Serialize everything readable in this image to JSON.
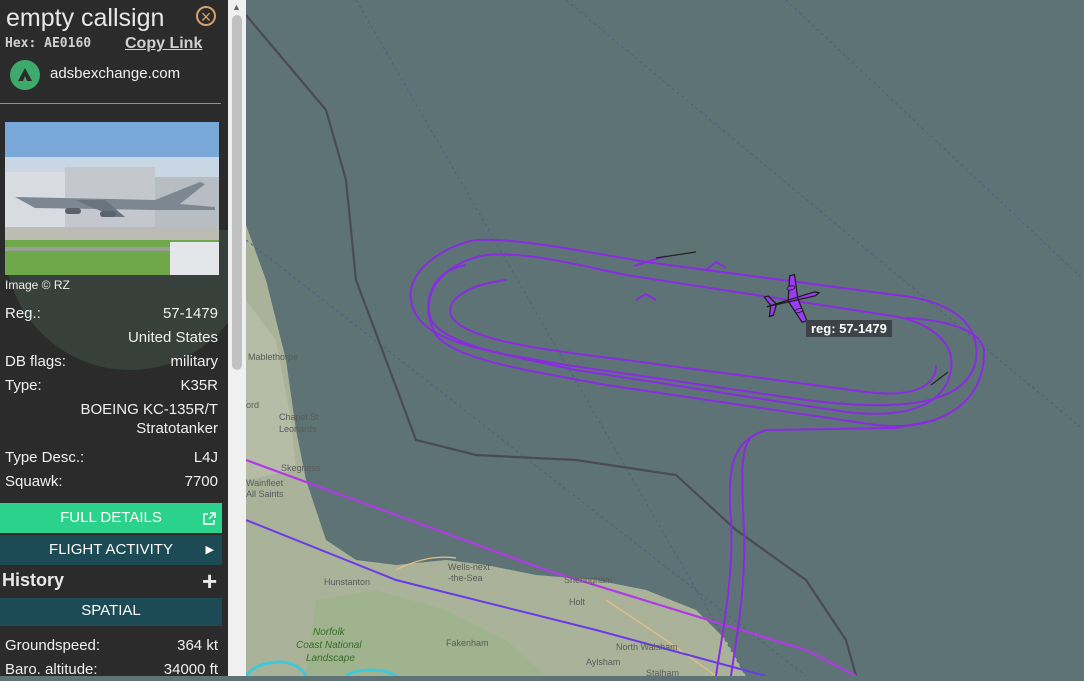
{
  "sidebar": {
    "title": "empty callsign",
    "hex_label": "Hex:",
    "hex_value": "AE0160",
    "copy_link": "Copy Link",
    "site": "adsbexchange.com",
    "image_credit": "Image © RZ",
    "fields": [
      {
        "label": "Reg.:",
        "value": "57-1479"
      },
      {
        "label": "",
        "value": "United States"
      },
      {
        "label": "DB flags:",
        "value": "military"
      },
      {
        "label": "Type:",
        "value": "K35R"
      },
      {
        "label": "",
        "value": "BOEING KC-135R/T"
      },
      {
        "label": "",
        "value": "Stratotanker"
      },
      {
        "label": "Type Desc.:",
        "value": "L4J"
      },
      {
        "label": "Squawk:",
        "value": "7700"
      }
    ],
    "full_details": "FULL DETAILS",
    "flight_activity": "FLIGHT ACTIVITY",
    "history": "History",
    "spatial": "SPATIAL",
    "spatial_fields": [
      {
        "label": "Groundspeed:",
        "value": "364 kt"
      },
      {
        "label": "Baro. altitude:",
        "value": "34000 ft"
      }
    ]
  },
  "map": {
    "aircraft_tag": "reg: 57-1479",
    "towns": [
      "Mablethorpe",
      "Chapel St",
      "Leonards",
      "Skegness",
      "Wainfleet",
      "All Saints",
      "Hunstanton",
      "Wells-next",
      "-the-Sea",
      "Sheringham",
      "Holt",
      "Fakenham",
      "North Walsham",
      "Aylsham",
      "Stalham",
      "ord"
    ],
    "green_labels": [
      "Norfolk",
      "Coast National",
      "Landscape"
    ],
    "colors": {
      "sea": "#5e7376",
      "track": "#8a2be2",
      "aircraft": "#9b3cf0"
    }
  },
  "icons": [
    "close-icon",
    "external-link-icon",
    "chevron-right-icon",
    "plus-icon",
    "aircraft-icon",
    "adsb-logo-icon"
  ]
}
